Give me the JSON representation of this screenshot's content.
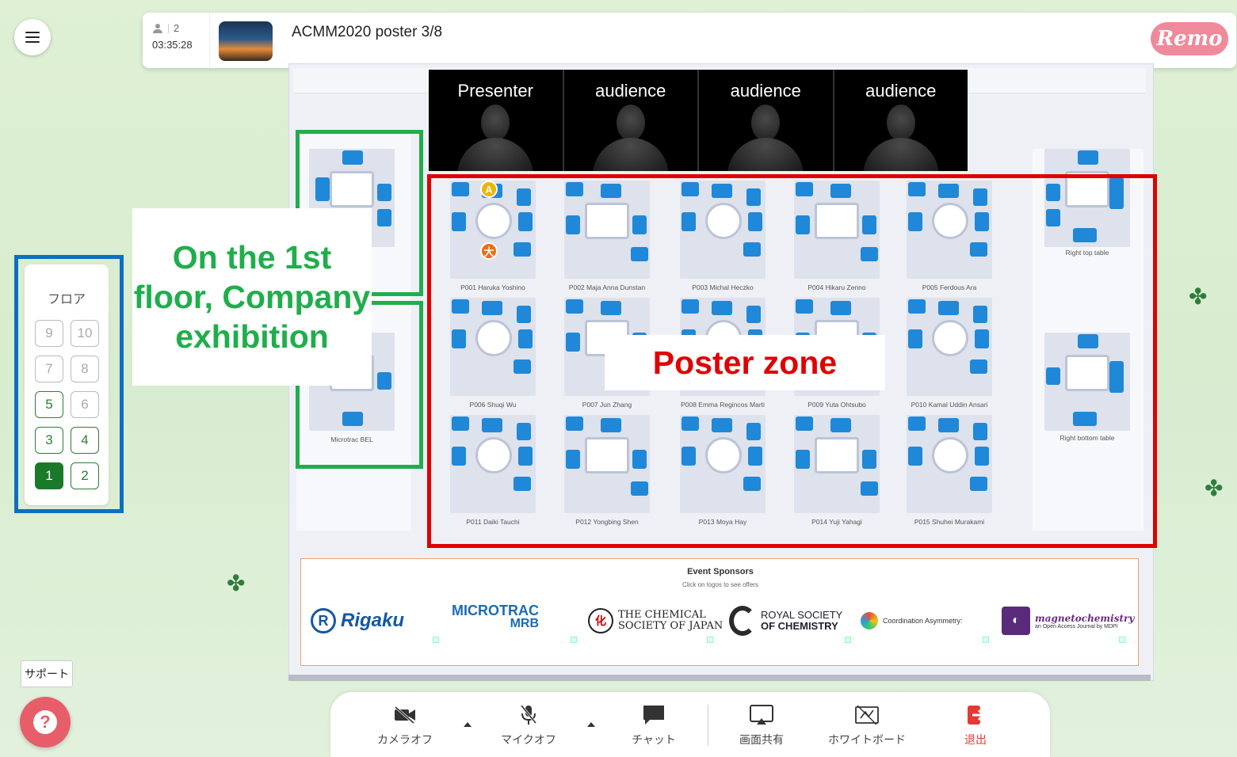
{
  "header": {
    "participant_count": "2",
    "elapsed_time": "03:35:28",
    "event_title": "ACMM2020 poster 3/8",
    "brand": "Remo"
  },
  "floor_panel": {
    "title": "フロア",
    "floors": [
      "9",
      "10",
      "7",
      "8",
      "5",
      "6",
      "3",
      "4",
      "1",
      "2"
    ],
    "current_floor": "1"
  },
  "video_tiles": [
    "Presenter",
    "audience",
    "audience",
    "audience"
  ],
  "tables": {
    "left": [
      "",
      "Microtrac BEL"
    ],
    "right": [
      "Right top table",
      "Right bottom table"
    ],
    "posters": [
      "P001 Haruka Yoshino",
      "P002 Maja Anna Dunstan",
      "P003 Michal Heczko",
      "P004 Hikaru Zenno",
      "P005 Ferdous Ara",
      "P006 Shuqi Wu",
      "P007 Jun Zhang",
      "P008 Emma Regincos Marti",
      "P009 Yuta Ohtsubo",
      "P010 Kamal Uddin Ansari",
      "P011 Daiki Tauchi",
      "P012 Yongbing Shen",
      "P013 Moya Hay",
      "P014 Yuji Yahagi",
      "P015 Shuhei Murakami"
    ]
  },
  "avatars": [
    "A",
    "大"
  ],
  "annotations": {
    "company_exhibition": "On the 1st floor, Company exhibition",
    "poster_zone": "Poster zone"
  },
  "sponsors": {
    "title": "Event Sponsors",
    "subtitle": "Click on logos to see offers",
    "logos": {
      "rigaku": "Rigaku",
      "microtrac_top": "MICROTRAC",
      "microtrac_bottom": "MRB",
      "csj_line1": "THE CHEMICAL",
      "csj_line2": "SOCIETY OF JAPAN",
      "csj_mark": "化",
      "rsc_line1": "ROYAL SOCIETY",
      "rsc_line2": "OF CHEMISTRY",
      "coord": "Coordination Asymmetry:",
      "mag_title": "magnetochemistry",
      "mag_sub": "an Open Access Journal by MDPI"
    }
  },
  "toolbar": {
    "camera": "カメラオフ",
    "mic": "マイクオフ",
    "chat": "チャット",
    "screen_share": "画面共有",
    "whiteboard": "ホワイトボード",
    "exit": "退出"
  },
  "support": {
    "tooltip": "サポート",
    "icon_text": "?"
  },
  "colors": {
    "accent_green": "#1fae4b",
    "zone_red": "#e00000",
    "floor_blue": "#0b6fc2",
    "seat_blue": "#1f88d8",
    "remo_pink": "#f08a9a"
  }
}
